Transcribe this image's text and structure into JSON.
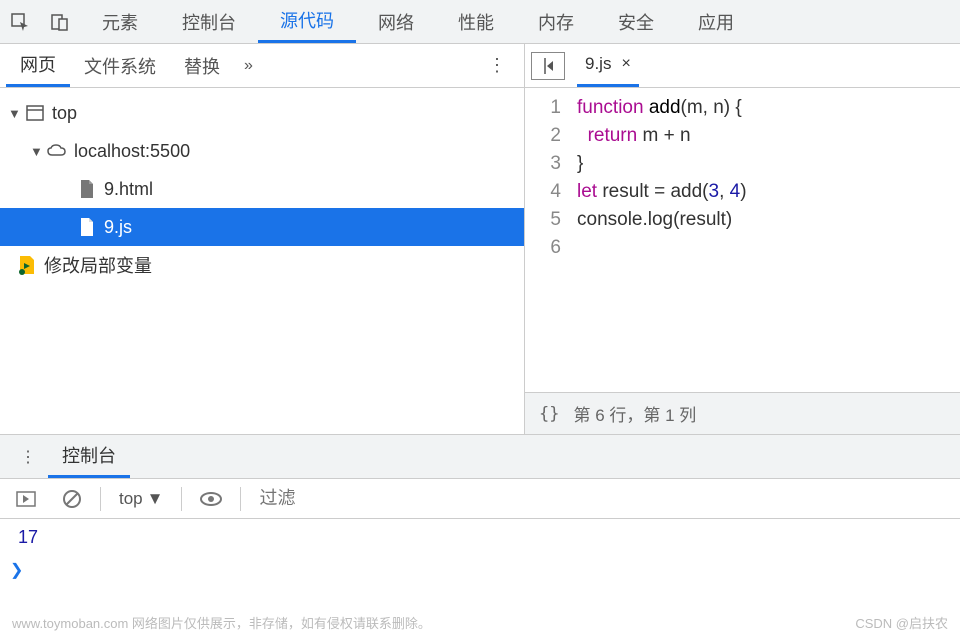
{
  "toolbar": {
    "inspect_icon": "inspect",
    "device_icon": "device"
  },
  "topTabs": [
    "元素",
    "控制台",
    "源代码",
    "网络",
    "性能",
    "内存",
    "安全",
    "应用"
  ],
  "topActiveIndex": 2,
  "leftTabs": [
    "网页",
    "文件系统",
    "替换"
  ],
  "leftActiveIndex": 0,
  "tree": {
    "top": "top",
    "host": "localhost:5500",
    "files": [
      "9.html",
      "9.js"
    ],
    "selectedFile": "9.js",
    "workspace": "修改局部变量"
  },
  "editor": {
    "fileName": "9.js",
    "lines": [
      {
        "n": 1,
        "html": "<span class='kw'>function</span> <span class='fn'>add</span>(m, n) {"
      },
      {
        "n": 2,
        "html": "  <span class='kw'>return</span> m + n"
      },
      {
        "n": 3,
        "html": "}"
      },
      {
        "n": 4,
        "html": "<span class='kw'>let</span> result = add(<span class='num'>3</span>, <span class='num'>4</span>)"
      },
      {
        "n": 5,
        "html": "console.log(result)"
      },
      {
        "n": 6,
        "html": ""
      }
    ],
    "status": "第 6 行，第 1 列"
  },
  "console": {
    "title": "控制台",
    "context": "top",
    "filterPlaceholder": "过滤",
    "output": "17"
  },
  "footer": {
    "left": "www.toymoban.com 网络图片仅供展示，非存储，如有侵权请联系删除。",
    "right": "CSDN @启扶农"
  }
}
